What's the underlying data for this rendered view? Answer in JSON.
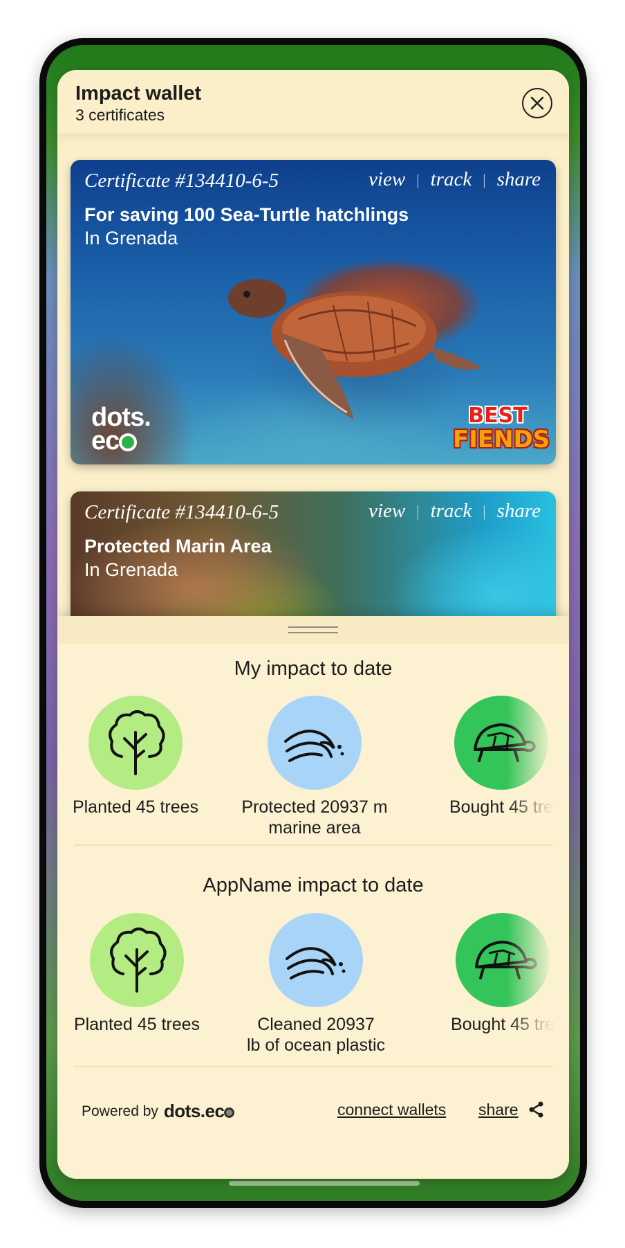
{
  "wallet": {
    "title": "Impact wallet",
    "subtitle": "3 certificates"
  },
  "certificates": [
    {
      "number": "Certificate #134410-6-5",
      "actions": [
        "view",
        "track",
        "share"
      ],
      "title": "For saving 100 Sea-Turtle hatchlings",
      "place": "In Grenada",
      "logos": {
        "left_line1": "dots.",
        "left_line2": "ec",
        "right_line1": "BEST",
        "right_line2": "FIENDS"
      }
    },
    {
      "number": "Certificate #134410-6-5",
      "actions": [
        "view",
        "track",
        "share"
      ],
      "title": "Protected Marin Area",
      "place": "In Grenada"
    }
  ],
  "my_impact": {
    "title": "My impact to date",
    "items": [
      {
        "icon": "tree-icon",
        "label": "Planted 45 trees",
        "color": "#b3ec83"
      },
      {
        "icon": "wave-icon",
        "label_line1": "Protected 20937 m",
        "label_line2": "marine area",
        "color": "#a8d5f7"
      },
      {
        "icon": "turtle-icon",
        "label": "Bought 45 tre",
        "color": "#33c45a"
      }
    ]
  },
  "app_impact": {
    "title": "AppName impact to date",
    "items": [
      {
        "icon": "tree-icon",
        "label": "Planted 45 trees",
        "color": "#b3ec83"
      },
      {
        "icon": "wave-icon",
        "label_line1": "Cleaned 20937",
        "label_line2": "lb of ocean plastic",
        "color": "#a8d5f7"
      },
      {
        "icon": "turtle-icon",
        "label": "Bought 45 tre",
        "color": "#33c45a"
      }
    ]
  },
  "footer": {
    "powered_by": "Powered by",
    "brand": "dots.ec",
    "connect_wallets": "connect wallets",
    "share": "share"
  }
}
